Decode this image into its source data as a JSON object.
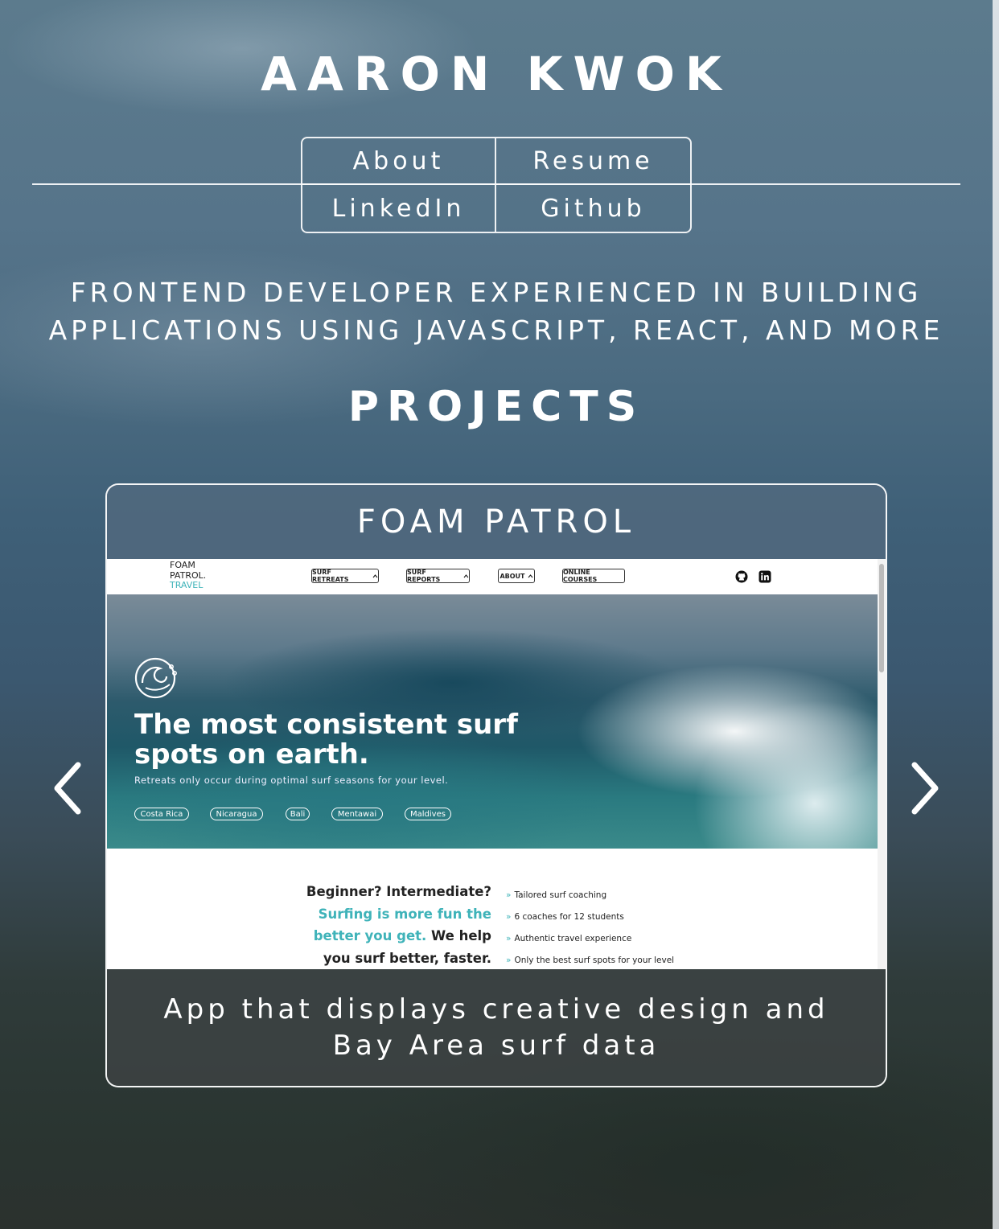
{
  "header": {
    "name": "AARON KWOK"
  },
  "nav": {
    "about": "About",
    "resume": "Resume",
    "linkedin": "LinkedIn",
    "github": "Github"
  },
  "tagline": "FRONTEND DEVELOPER EXPERIENCED IN BUILDING APPLICATIONS USING JAVASCRIPT, REACT, AND MORE",
  "projects": {
    "title": "PROJECTS",
    "prev_icon": "chevron-left-icon",
    "next_icon": "chevron-right-icon",
    "card": {
      "title": "FOAM PATROL",
      "description": "App that displays creative design and Bay Area surf data",
      "screenshot": {
        "logo_line1": "FOAM",
        "logo_line2": "PATROL.",
        "logo_line3": "TRAVEL",
        "nav": [
          "SURF RETREATS",
          "SURF REPORTS",
          "ABOUT",
          "ONLINE COURSES"
        ],
        "hero_title": "The most consistent surf spots on earth.",
        "hero_sub": "Retreats only occur during optimal surf seasons for your level.",
        "chips": [
          "Costa Rica",
          "Nicaragua",
          "Bali",
          "Mentawai",
          "Maldives"
        ],
        "lead_1": "Beginner? Intermediate?",
        "lead_2": "Surfing is more fun the better you get.",
        "lead_3": "We help you surf better, faster.",
        "list": [
          "Tailored surf coaching",
          "6 coaches for 12 students",
          "Authentic travel experience",
          "Only the best surf spots for your level"
        ]
      }
    }
  },
  "colors": {
    "teal_accent": "#3fb3b9",
    "text": "#ffffff"
  }
}
